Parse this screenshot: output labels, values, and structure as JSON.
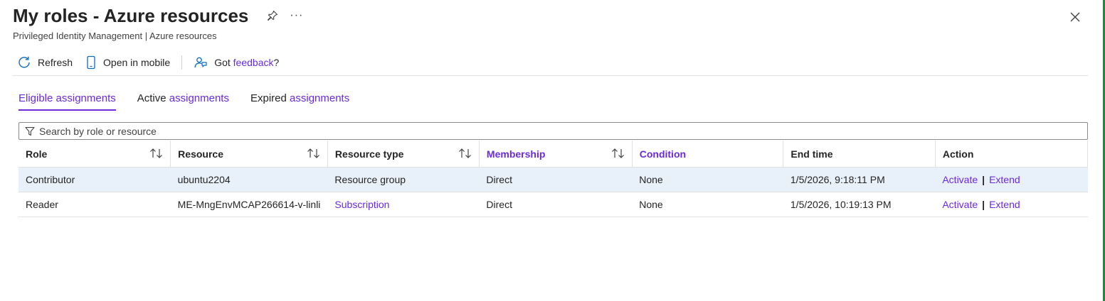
{
  "header": {
    "title": "My roles - Azure resources",
    "subtitle": "Privileged Identity Management | Azure resources",
    "more_label": "···"
  },
  "toolbar": {
    "refresh_label": "Refresh",
    "open_mobile_label": "Open in mobile",
    "feedback_prefix": "Got ",
    "feedback_link": "feedback",
    "feedback_suffix": "?"
  },
  "tabs": [
    {
      "label": "Eligible assignments"
    },
    {
      "prefix": "Active ",
      "link": "assignments"
    },
    {
      "prefix": "Expired ",
      "link": "assignments"
    }
  ],
  "search": {
    "placeholder": "Search by role or resource"
  },
  "table": {
    "columns": [
      "Role",
      "Resource",
      "Resource type",
      "Membership",
      "Condition",
      "End time",
      "Action"
    ],
    "rows": [
      {
        "role": "Contributor",
        "resource": "ubuntu2204",
        "resource_type": "Resource group",
        "membership": "Direct",
        "condition": "None",
        "end_time": "1/5/2026, 9:18:11 PM",
        "activate": "Activate",
        "separator": "|",
        "extend": "Extend"
      },
      {
        "role": "Reader",
        "resource": "ME-MngEnvMCAP266614-v-linli",
        "resource_type": "Subscription",
        "membership": "Direct",
        "condition": "None",
        "end_time": "1/5/2026, 10:19:13 PM",
        "activate": "Activate",
        "separator": "|",
        "extend": "Extend"
      }
    ]
  },
  "colors": {
    "accent": "#6b2bd9",
    "selected_row": "#e8f0fa",
    "icon_blue": "#0f6cbd"
  }
}
